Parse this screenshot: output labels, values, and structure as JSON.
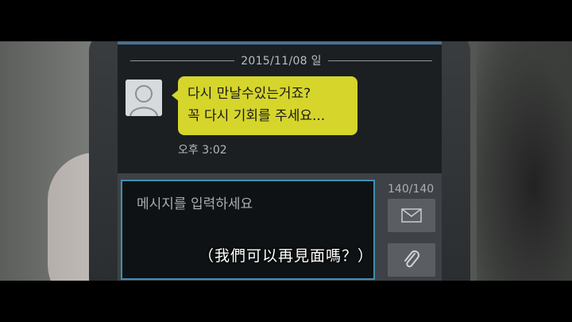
{
  "chat": {
    "date": "2015/11/08 일",
    "message_line1": "다시 만날수있는거죠?",
    "message_line2": "꼭 다시 기회를 주세요...",
    "time": "오후 3:02"
  },
  "compose": {
    "placeholder": "메시지를 입력하세요",
    "char_count": "140/140",
    "send_icon": "envelope-icon",
    "attach_icon": "paperclip-icon"
  },
  "subtitle": "（我們可以再見面嗎？）",
  "colors": {
    "bubble": "#d6d52c",
    "input_border": "#3f8fb3",
    "screen_bg": "#1b1f22"
  }
}
